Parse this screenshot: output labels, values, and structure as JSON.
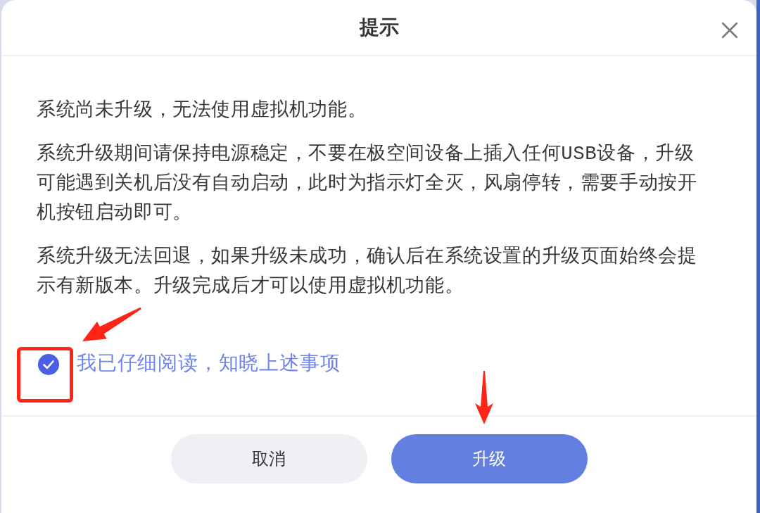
{
  "dialog": {
    "title": "提示"
  },
  "paragraphs": [
    "系统尚未升级，无法使用虚拟机功能。",
    "系统升级期间请保持电源稳定，不要在极空间设备上插入任何USB设备，升级可能遇到关机后没有自动启动，此时为指示灯全灭，风扇停转，需要手动按开机按钮启动即可。",
    "系统升级无法回退，如果升级未成功，确认后在系统设置的升级页面始终会提示有新版本。升级完成后才可以使用虚拟机功能。"
  ],
  "agreement": {
    "label": "我已仔细阅读，知晓上述事项",
    "checked": true
  },
  "buttons": [
    {
      "label": "取消",
      "kind": "secondary"
    },
    {
      "label": "升级",
      "kind": "primary"
    }
  ],
  "annotations": [
    {
      "kind": "frame"
    },
    {
      "kind": "arrow"
    },
    {
      "kind": "arrow"
    }
  ]
}
